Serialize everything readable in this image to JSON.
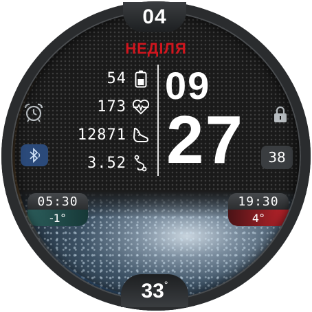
{
  "date": {
    "day_number": "04",
    "weekday": "НЕДІЛЯ"
  },
  "time": {
    "hour": "09",
    "minute": "27"
  },
  "stats": [
    {
      "value": "54",
      "icon": "battery-icon"
    },
    {
      "value": "173",
      "icon": "heart-rate-icon"
    },
    {
      "value": "12871",
      "icon": "steps-shoe-icon"
    },
    {
      "value": "3.52",
      "icon": "distance-route-icon"
    }
  ],
  "right_complication": {
    "value": "38"
  },
  "sunrise": {
    "time": "05:30",
    "temp": "-1°"
  },
  "sunset": {
    "time": "19:30",
    "temp": "4°"
  },
  "weather": {
    "temperature": "33",
    "degree": "°"
  },
  "colors": {
    "accent_red": "#d0161e",
    "bluetooth_bg": "#2b4a7a",
    "low_temp_bg": "#2c5e5c",
    "high_temp_bg": "#c1242c"
  }
}
